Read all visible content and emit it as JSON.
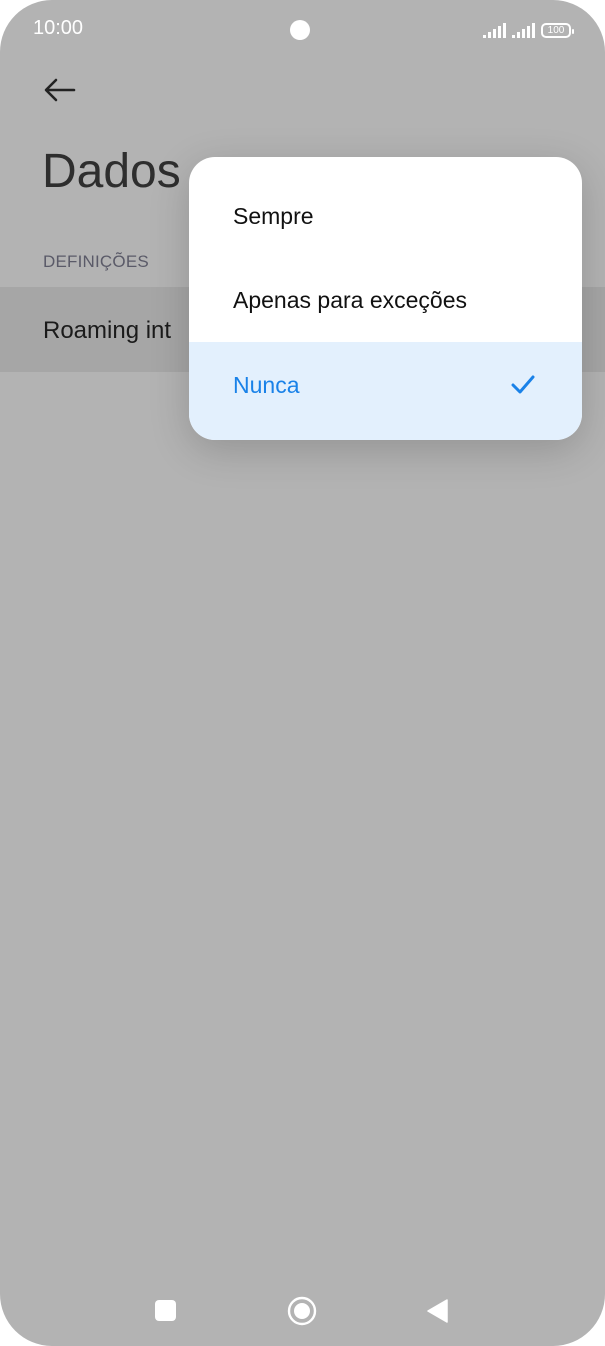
{
  "status_bar": {
    "time": "10:00",
    "battery": "100"
  },
  "page": {
    "title": "Dados",
    "section_label": "DEFINIÇÕES",
    "row_label": "Roaming int"
  },
  "popup": {
    "options": [
      {
        "label": "Sempre",
        "selected": false
      },
      {
        "label": "Apenas para exceções",
        "selected": false
      },
      {
        "label": "Nunca",
        "selected": true
      }
    ]
  },
  "colors": {
    "accent": "#1a82e8",
    "selected_bg": "#e3f0fd",
    "dim_overlay": "#b3b3b3"
  },
  "icons": {
    "back": "back-arrow-icon",
    "check": "checkmark-icon",
    "recents": "square-icon",
    "home": "circle-icon",
    "nav_back": "triangle-back-icon"
  }
}
